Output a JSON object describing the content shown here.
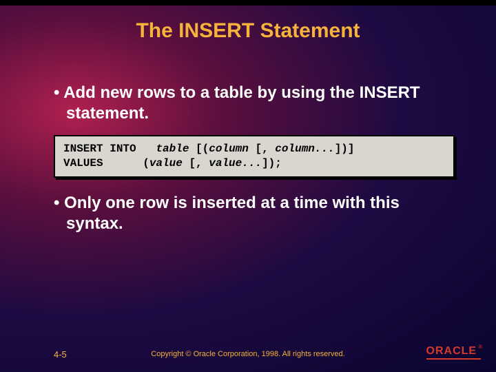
{
  "title": "The INSERT Statement",
  "bullets": {
    "b1": "Add new rows to a table by using the INSERT statement.",
    "b2": "Only one row is inserted at a time with this syntax."
  },
  "code": {
    "line1_kw1": "INSERT INTO",
    "line1_table": "table",
    "line1_rest1": " [(",
    "line1_col1": "column",
    "line1_rest2": " [, ",
    "line1_col2": "column...",
    "line1_rest3": "])]",
    "line2_kw": "VALUES",
    "line2_rest1": "(",
    "line2_val1": "value",
    "line2_rest2": " [, ",
    "line2_val2": "value...",
    "line2_rest3": "]);"
  },
  "footer": {
    "page": "4-5",
    "copyright": "Copyright © Oracle Corporation, 1998. All rights reserved.",
    "logo_text": "ORACLE",
    "logo_reg": "®"
  }
}
